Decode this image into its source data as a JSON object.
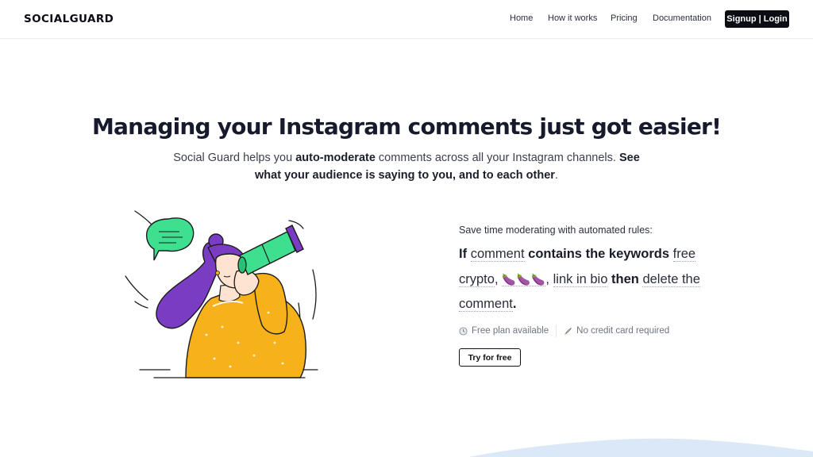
{
  "brand": {
    "logo_text": "SOCIALGUARD"
  },
  "nav": {
    "links": [
      {
        "label": "Home"
      },
      {
        "label": "How it works"
      },
      {
        "label": "Pricing"
      },
      {
        "label": "Documentation"
      }
    ],
    "cta_label": "Signup | Login"
  },
  "hero": {
    "headline_part1": "Managing your Instagram comments ",
    "headline_highlight": "just got easier",
    "headline_end": "!",
    "sub": {
      "t1": "Social Guard helps you ",
      "b1": "auto-moderate",
      "t2": " comments across all your Instagram channels. ",
      "b2": "See what your audience is saying to you, and to each other",
      "t3": "."
    }
  },
  "rule": {
    "intro": "Save time moderating with automated rules:",
    "if": "If",
    "field": "comment",
    "operator": "contains the keywords",
    "keywords_1": "free crypto",
    "comma_1": ",",
    "emoji": "🍆🍆🍆",
    "comma_2": ",",
    "keywords_2": "link in bio",
    "then": "then",
    "action": "delete the comment",
    "period": "."
  },
  "perks": [
    {
      "icon": "clock-icon",
      "label": "Free plan available"
    },
    {
      "icon": "rocket-icon",
      "label": "No credit card required"
    }
  ],
  "cta": {
    "label": "Try for free"
  },
  "colors": {
    "accent_dark": "#0b0c14",
    "highlight": "#f6bcb8",
    "illustration_yellow": "#f7b21b",
    "illustration_purple": "#7b3cc4",
    "illustration_green": "#3ee08f",
    "wave_blue": "#dbe8f8"
  }
}
